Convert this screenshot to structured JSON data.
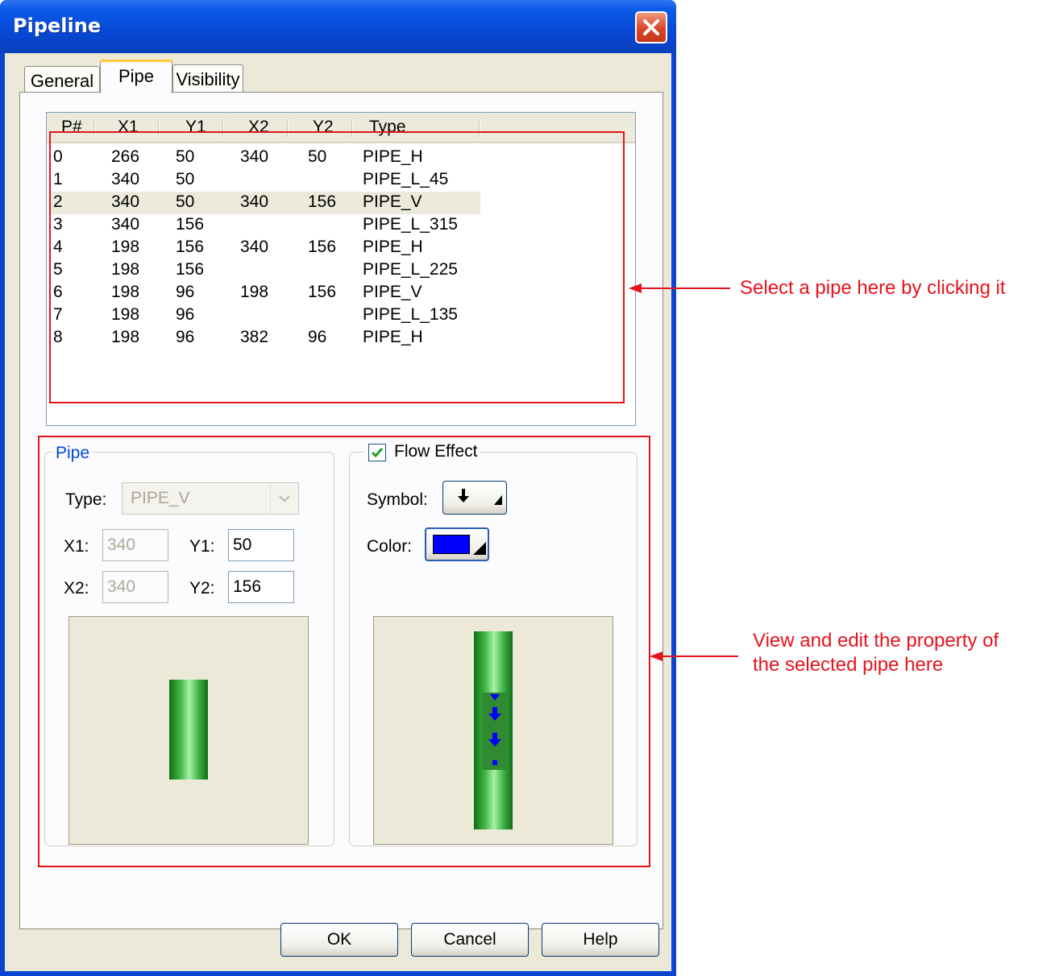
{
  "window": {
    "title": "Pipeline"
  },
  "tabs": [
    "General",
    "Pipe",
    "Visibility"
  ],
  "list": {
    "headers": [
      "P#",
      "X1",
      "Y1",
      "X2",
      "Y2",
      "Type"
    ],
    "rows": [
      [
        "0",
        "266",
        "50",
        "340",
        "50",
        "PIPE_H"
      ],
      [
        "1",
        "340",
        "50",
        "",
        "",
        "PIPE_L_45"
      ],
      [
        "2",
        "340",
        "50",
        "340",
        "156",
        "PIPE_V"
      ],
      [
        "3",
        "340",
        "156",
        "",
        "",
        "PIPE_L_315"
      ],
      [
        "4",
        "198",
        "156",
        "340",
        "156",
        "PIPE_H"
      ],
      [
        "5",
        "198",
        "156",
        "",
        "",
        "PIPE_L_225"
      ],
      [
        "6",
        "198",
        "96",
        "198",
        "156",
        "PIPE_V"
      ],
      [
        "7",
        "198",
        "96",
        "",
        "",
        "PIPE_L_135"
      ],
      [
        "8",
        "198",
        "96",
        "382",
        "96",
        "PIPE_H"
      ]
    ],
    "selected_row": 2
  },
  "pipe_group": {
    "title": "Pipe",
    "type_label": "Type:",
    "type_value": "PIPE_V",
    "x1_label": "X1:",
    "x1_value": "340",
    "y1_label": "Y1:",
    "y1_value": "50",
    "x2_label": "X2:",
    "x2_value": "340",
    "y2_label": "Y2:",
    "y2_value": "156"
  },
  "flow_group": {
    "title": "Flow Effect",
    "checked": true,
    "symbol_label": "Symbol:",
    "color_label": "Color:",
    "flow_color": "#0000ff"
  },
  "buttons": {
    "ok": "OK",
    "cancel": "Cancel",
    "help": "Help"
  },
  "annotations": {
    "select_pipe": "Select a pipe here by clicking it",
    "edit_line1": "View and edit the property of",
    "edit_line2": "the selected pipe here"
  },
  "colors": {
    "annotation": "#e8121c",
    "pipe_green": "#46b94a",
    "title_bar": "#0a5ae8"
  }
}
